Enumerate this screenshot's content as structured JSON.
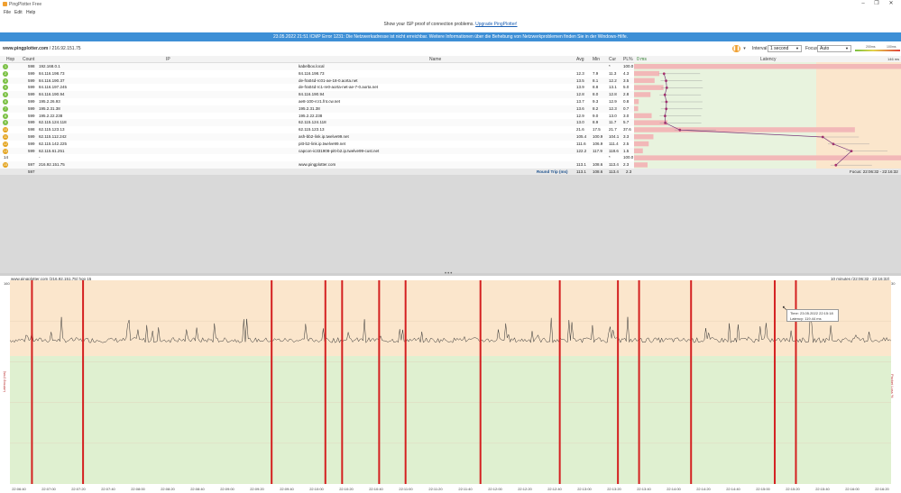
{
  "window": {
    "title": "PingPlotter Free"
  },
  "menu": [
    "File",
    "Edit",
    "Help"
  ],
  "promo": {
    "text": "Show your ISP proof of connection problems.",
    "link": "Upgrade PingPlotter!"
  },
  "banner": "23.05.2022 21:51 ICMP Error 1231: Die Netzwerkadresse ist nicht erreichbar. Weitere Informationen über die Behebung von Netzwerkproblemen finden Sie in der Windows-Hilfe.",
  "target": {
    "host": "www.pingplotter.com",
    "ip": "/ 216.92.151.75"
  },
  "controls": {
    "interval_label": "Interval",
    "interval_value": "1 second",
    "focus_label": "Focus",
    "focus_value": "Auto",
    "scale_low": "200ms",
    "scale_high": "100ms"
  },
  "columns": {
    "hop": "Hop",
    "count": "Count",
    "ip": "IP",
    "name": "Name",
    "avg": "Avg",
    "min": "Min",
    "cur": "Cur",
    "pl": "PL%",
    "zero": "0 ms",
    "latency": "Latency",
    "max": "146 ms"
  },
  "hops": [
    {
      "hop": "1",
      "count": "598",
      "ip": "192.168.0.1",
      "name": "kabelbox.local",
      "avg": "",
      "min": "",
      "cur": "*",
      "pl": "100.0",
      "color": "#7ac043"
    },
    {
      "hop": "2",
      "count": "599",
      "ip": "84.116.198.73",
      "name": "84.116.198.73",
      "avg": "12.3",
      "min": "7.9",
      "cur": "11.3",
      "pl": "4.3",
      "color": "#7ac043"
    },
    {
      "hop": "3",
      "count": "599",
      "ip": "84.116.190.37",
      "name": "de-fra04d-rc01-ae-18-0.aorta.net",
      "avg": "13.5",
      "min": "8.1",
      "cur": "12.2",
      "pl": "3.5",
      "color": "#7ac043"
    },
    {
      "hop": "4",
      "count": "599",
      "ip": "84.116.197.245",
      "name": "de-fra04d-rc1-re0-aorta-net-ae-7-0.aorta.net",
      "avg": "13.9",
      "min": "8.8",
      "cur": "13.1",
      "pl": "5.0",
      "color": "#7ac043"
    },
    {
      "hop": "5",
      "count": "599",
      "ip": "84.116.190.94",
      "name": "84.116.190.94",
      "avg": "12.8",
      "min": "8.0",
      "cur": "12.8",
      "pl": "2.8",
      "color": "#7ac043"
    },
    {
      "hop": "6",
      "count": "599",
      "ip": "195.2.26.93",
      "name": "ae8-100-rcr1.fnt.cw.net",
      "avg": "13.7",
      "min": "9.3",
      "cur": "12.9",
      "pl": "0.8",
      "color": "#7ac043"
    },
    {
      "hop": "7",
      "count": "599",
      "ip": "195.2.31.38",
      "name": "195.2.31.38",
      "avg": "13.6",
      "min": "8.2",
      "cur": "12.3",
      "pl": "0.7",
      "color": "#7ac043"
    },
    {
      "hop": "8",
      "count": "599",
      "ip": "195.2.22.238",
      "name": "195.2.22.238",
      "avg": "12.9",
      "min": "9.0",
      "cur": "13.0",
      "pl": "3.0",
      "color": "#7ac043"
    },
    {
      "hop": "9",
      "count": "599",
      "ip": "62.115.124.118",
      "name": "62.115.124.118",
      "avg": "13.0",
      "min": "8.9",
      "cur": "11.7",
      "pl": "5.7",
      "color": "#7ac043"
    },
    {
      "hop": "10",
      "count": "598",
      "ip": "62.115.123.13",
      "name": "62.115.123.13",
      "avg": "21.6",
      "min": "17.5",
      "cur": "21.7",
      "pl": "37.6",
      "color": "#e3a21a"
    },
    {
      "hop": "11",
      "count": "599",
      "ip": "62.115.112.242",
      "name": "ash-bb2-link.ip.twelve99.net",
      "avg": "105.4",
      "min": "100.9",
      "cur": "104.1",
      "pl": "3.3",
      "color": "#e3a21a"
    },
    {
      "hop": "12",
      "count": "599",
      "ip": "62.115.142.225",
      "name": "pitt-b2-link.ip.twelve99.net",
      "avg": "111.6",
      "min": "106.9",
      "cur": "111.4",
      "pl": "2.5",
      "color": "#e3a21a"
    },
    {
      "hop": "13",
      "count": "599",
      "ip": "62.115.61.251",
      "name": "capcon-ic331908-pitt-b2.ip.twelve99-cust.net",
      "avg": "122.2",
      "min": "117.9",
      "cur": "118.6",
      "pl": "1.5",
      "color": "#e3a21a"
    },
    {
      "hop": "14",
      "count": "",
      "ip": "-",
      "name": "",
      "avg": "",
      "min": "",
      "cur": "*",
      "pl": "100.0",
      "color": ""
    },
    {
      "hop": "15",
      "count": "597",
      "ip": "216.92.151.75",
      "name": "www.pingplotter.com",
      "avg": "113.1",
      "min": "108.6",
      "cur": "113.4",
      "pl": "2.3",
      "color": "#e3a21a"
    }
  ],
  "summary": {
    "count": "597",
    "label": "Round Trip (ms)",
    "avg": "113.1",
    "min": "108.6",
    "cur": "113.4",
    "pl": "2.3",
    "focus": "Focus: 22:06:32 - 22:16:32"
  },
  "graph": {
    "title": "www.pingplotter.com (216.92.151.75) hop 15",
    "range": "10 minutes (22:06:32 - 22:16:32)",
    "ymax": "160",
    "ymax_right": "30",
    "ylabel": "Latency (ms)",
    "ylabel_right": "Packet Loss %",
    "times": [
      "22:06:40",
      "22:07:00",
      "22:07:20",
      "22:07:40",
      "22:08:00",
      "22:08:20",
      "22:08:40",
      "22:09:00",
      "22:09:20",
      "22:09:40",
      "22:10:00",
      "22:10:20",
      "22:10:40",
      "22:11:00",
      "22:11:20",
      "22:11:40",
      "22:12:00",
      "22:12:20",
      "22:12:40",
      "22:13:00",
      "22:13:20",
      "22:13:40",
      "22:14:00",
      "22:14:20",
      "22:14:40",
      "22:15:00",
      "22:15:20",
      "22:15:40",
      "22:16:00",
      "22:16:20"
    ],
    "loss_fracs": [
      0.025,
      0.083,
      0.297,
      0.358,
      0.377,
      0.419,
      0.449,
      0.534,
      0.624,
      0.69,
      0.714,
      0.773,
      0.868,
      0.892
    ],
    "tooltip_time": "Time: 23.05.2022 22:15:18",
    "tooltip_latency": "Latency: 119.44 ms",
    "latency_base_ms": 113,
    "zones": {
      "green": "#dff0d0",
      "yellow": "#fbe6cc",
      "loss": "#d42020",
      "line": "#333333"
    }
  }
}
